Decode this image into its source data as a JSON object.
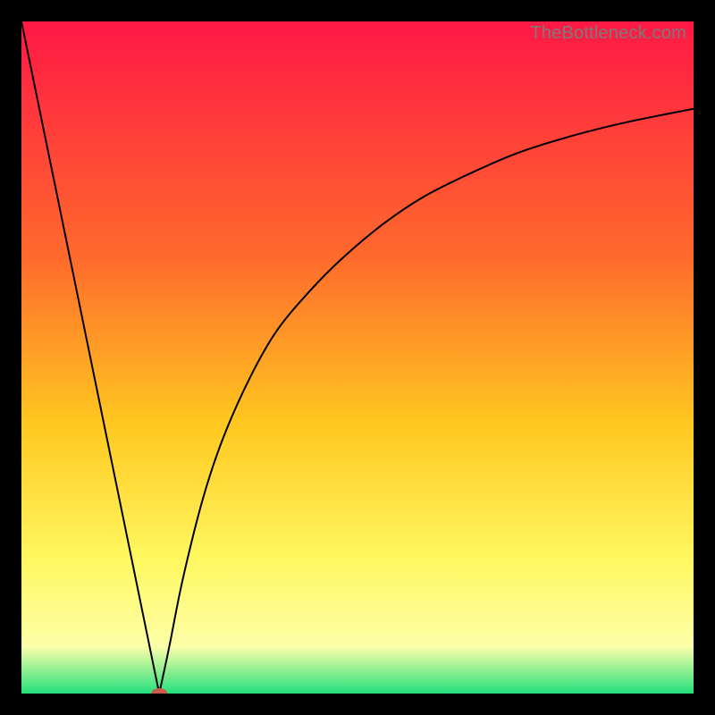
{
  "watermark": "TheBottleneck.com",
  "colors": {
    "gradient_top": "#ff1845",
    "gradient_mid1": "#ff6a2c",
    "gradient_mid2": "#ffc820",
    "gradient_mid3": "#fff860",
    "gradient_mid4": "#fdffa8",
    "gradient_bottom": "#24e07d",
    "curve": "#000000",
    "marker": "#cc5a4a",
    "frame": "#000000"
  },
  "chart_data": {
    "type": "line",
    "title": "",
    "xlabel": "",
    "ylabel": "",
    "xlim": [
      0,
      100
    ],
    "ylim": [
      0,
      100
    ],
    "series": [
      {
        "name": "left-segment",
        "x": [
          0,
          20.5
        ],
        "values": [
          100,
          0
        ]
      },
      {
        "name": "right-segment",
        "x": [
          20.5,
          22,
          24,
          27,
          30,
          34,
          38,
          43,
          48,
          54,
          60,
          67,
          74,
          82,
          90,
          100
        ],
        "values": [
          0,
          7,
          17,
          29,
          38,
          47,
          54,
          60,
          65,
          70,
          74,
          77.5,
          80.5,
          83,
          85,
          87
        ]
      }
    ],
    "marker": {
      "x": 20.5,
      "y": 0,
      "rx": 1.2,
      "ry": 0.8
    },
    "gradient_bands": [
      {
        "pos": 0.0,
        "label": "red"
      },
      {
        "pos": 0.35,
        "label": "orange"
      },
      {
        "pos": 0.6,
        "label": "yellow"
      },
      {
        "pos": 0.8,
        "label": "light-yellow"
      },
      {
        "pos": 0.93,
        "label": "pale"
      },
      {
        "pos": 1.0,
        "label": "green"
      }
    ]
  }
}
